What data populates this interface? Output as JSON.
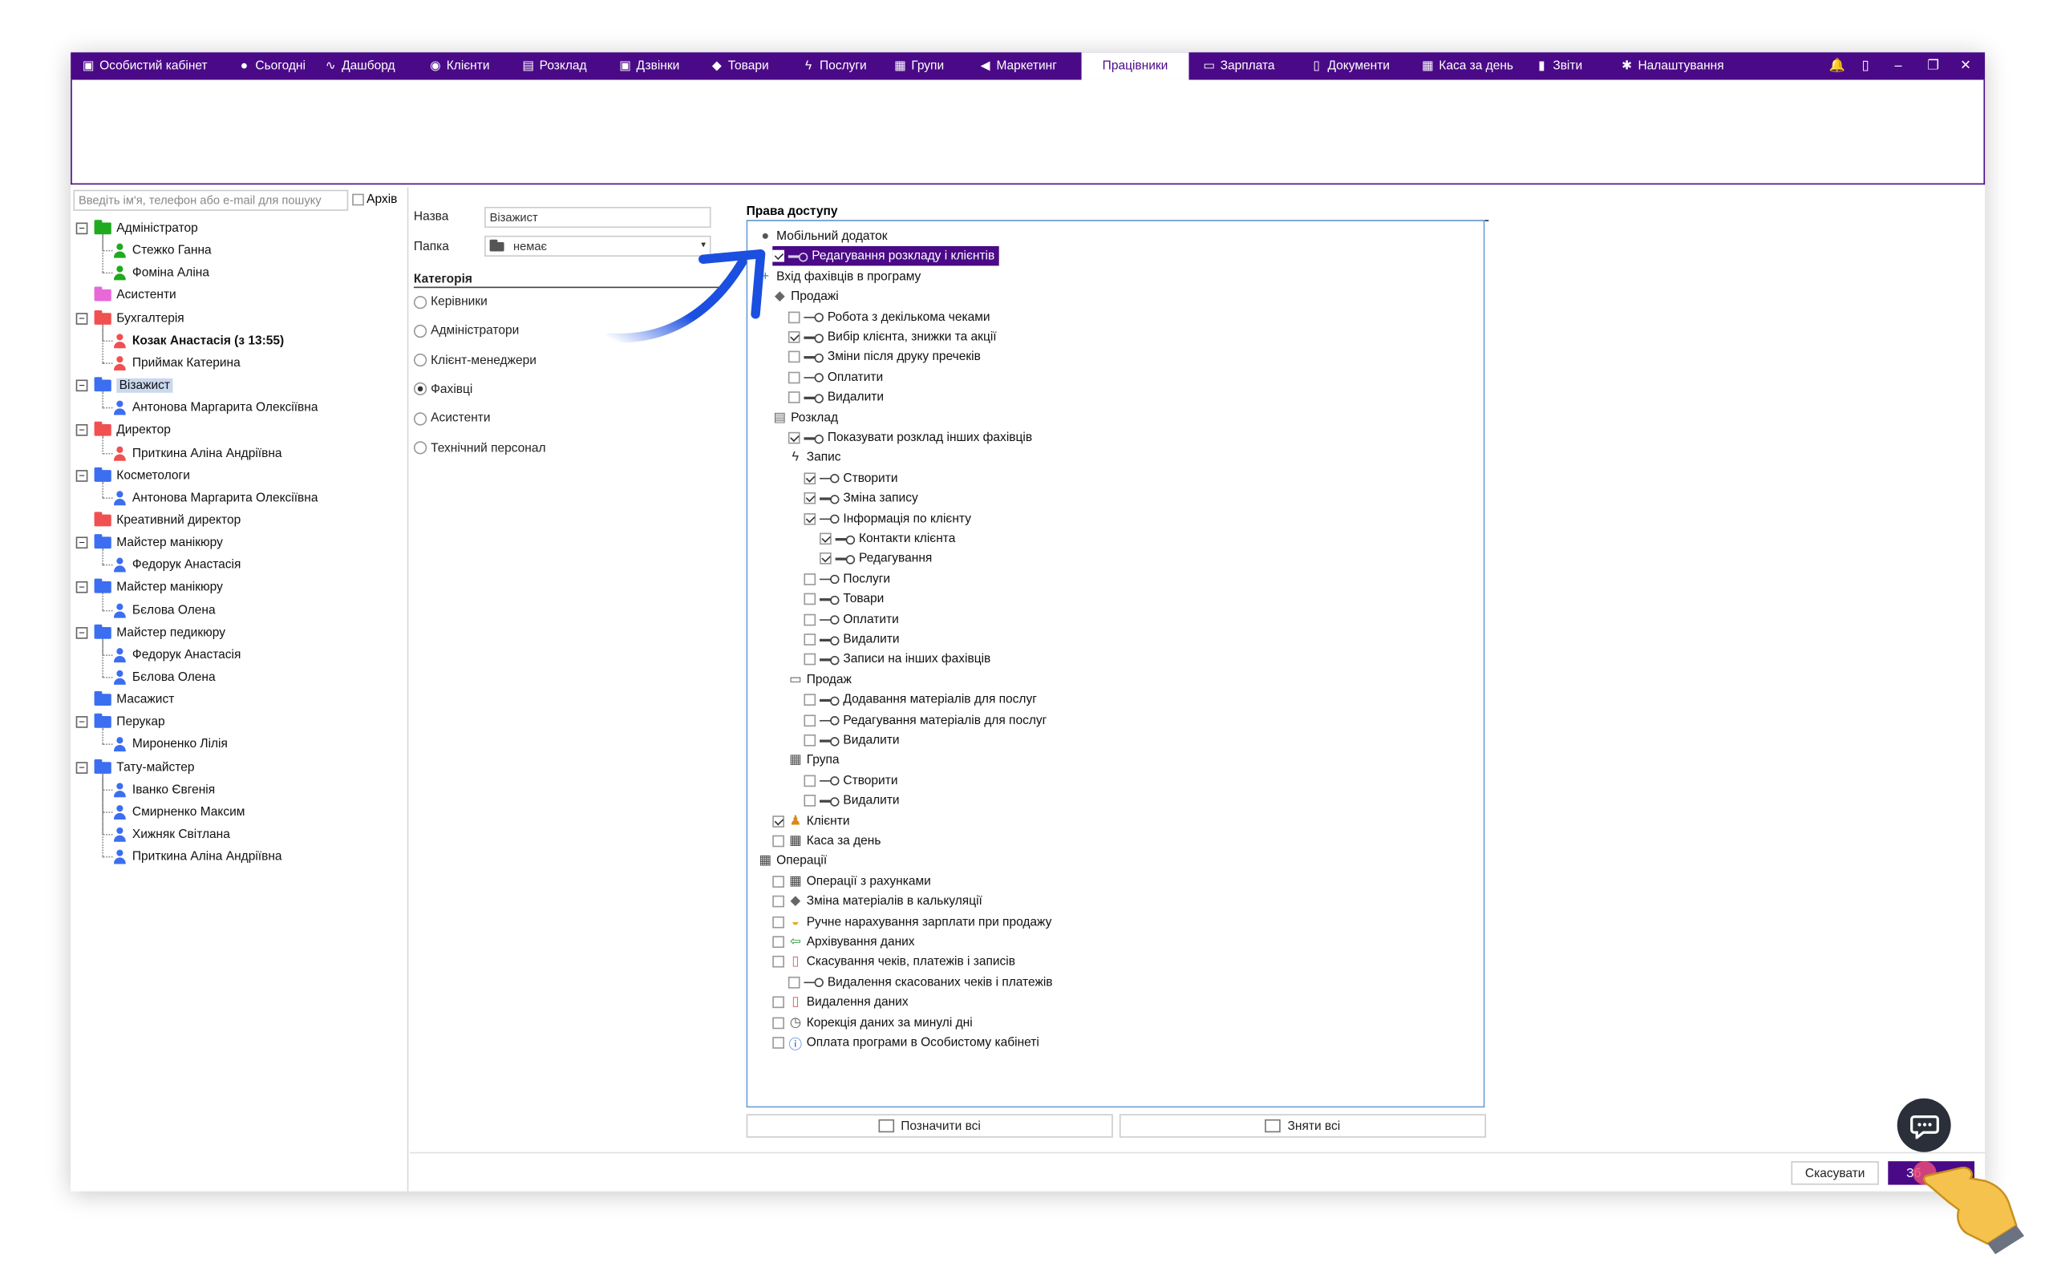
{
  "tabs": [
    {
      "label": "Особистий кабінет",
      "icon": "briefcase-icon"
    },
    {
      "label": "Сьогодні",
      "icon": "clock-icon"
    },
    {
      "label": "Дашборд",
      "icon": "pulse-icon"
    },
    {
      "label": "Клієнти",
      "icon": "user-circle-icon"
    },
    {
      "label": "Розклад",
      "icon": "calendar-icon"
    },
    {
      "label": "Дзвінки",
      "icon": "phone-icon"
    },
    {
      "label": "Товари",
      "icon": "box-icon"
    },
    {
      "label": "Послуги",
      "icon": "lightning-icon"
    },
    {
      "label": "Групи",
      "icon": "group-icon"
    },
    {
      "label": "Маркетинг",
      "icon": "megaphone-icon"
    },
    {
      "label": "Працівники",
      "icon": ""
    },
    {
      "label": "Зарплата",
      "icon": "cash-icon"
    },
    {
      "label": "Документи",
      "icon": "document-icon"
    },
    {
      "label": "Каса за день",
      "icon": "calculator-icon"
    },
    {
      "label": "Звіти",
      "icon": "bar-chart-icon"
    },
    {
      "label": "Налаштування",
      "icon": "gear-icon"
    }
  ],
  "active_tab": "Працівники",
  "window_controls": [
    "bell-icon",
    "lock-icon",
    "minimize-icon",
    "restore-icon",
    "close-icon"
  ],
  "search": {
    "placeholder": "Введіть ім'я, телефон або e-mail для пошуку",
    "archive_label": "Архів"
  },
  "tree": [
    {
      "type": "folder",
      "label": "Адміністратор",
      "color": "#1faa1f",
      "expand": "−"
    },
    {
      "type": "person",
      "label": "Стежко Ганна",
      "color": "#1faa1f"
    },
    {
      "type": "person",
      "label": "Фоміна Аліна",
      "color": "#1faa1f"
    },
    {
      "type": "folder",
      "label": "Асистенти",
      "color": "#e868d8",
      "expand": ""
    },
    {
      "type": "folder",
      "label": "Бухгалтерія",
      "color": "#f05050",
      "expand": "−"
    },
    {
      "type": "person",
      "label": "Козак Анастасія (з 13:55)",
      "color": "#f05050",
      "bold": true
    },
    {
      "type": "person",
      "label": "Приймак Катерина",
      "color": "#f05050"
    },
    {
      "type": "folder",
      "label": "Візажист",
      "color": "#3b6ef0",
      "expand": "−",
      "selected": true
    },
    {
      "type": "person",
      "label": "Антонова Маргарита Олексіївна",
      "color": "#3b6ef0"
    },
    {
      "type": "folder",
      "label": "Директор",
      "color": "#f05050",
      "expand": "−"
    },
    {
      "type": "person",
      "label": "Приткина Аліна Андріївна",
      "color": "#f05050"
    },
    {
      "type": "folder",
      "label": "Косметологи",
      "color": "#3b6ef0",
      "expand": "−"
    },
    {
      "type": "person",
      "label": "Антонова Маргарита Олексіївна",
      "color": "#3b6ef0"
    },
    {
      "type": "folder",
      "label": "Креативний директор",
      "color": "#f05050",
      "expand": ""
    },
    {
      "type": "folder",
      "label": "Майстер манікюру",
      "color": "#3b6ef0",
      "expand": "−"
    },
    {
      "type": "person",
      "label": "Федорук Анастасія",
      "color": "#3b6ef0"
    },
    {
      "type": "folder",
      "label": "Майстер манікюру",
      "color": "#3b6ef0",
      "expand": "−"
    },
    {
      "type": "person",
      "label": "Бєлова Олена",
      "color": "#3b6ef0"
    },
    {
      "type": "folder",
      "label": "Майстер педикюру",
      "color": "#3b6ef0",
      "expand": "−"
    },
    {
      "type": "person",
      "label": "Федорук Анастасія",
      "color": "#3b6ef0"
    },
    {
      "type": "person",
      "label": "Бєлова Олена",
      "color": "#3b6ef0"
    },
    {
      "type": "folder",
      "label": "Масажист",
      "color": "#3b6ef0",
      "expand": ""
    },
    {
      "type": "folder",
      "label": "Перукар",
      "color": "#3b6ef0",
      "expand": "−"
    },
    {
      "type": "person",
      "label": "Мироненко Лілія",
      "color": "#3b6ef0"
    },
    {
      "type": "folder",
      "label": "Тату-майстер",
      "color": "#3b6ef0",
      "expand": "−"
    },
    {
      "type": "person",
      "label": "Іванко Євгенія",
      "color": "#3b6ef0"
    },
    {
      "type": "person",
      "label": "Смирненко Максим",
      "color": "#3b6ef0"
    },
    {
      "type": "person",
      "label": "Хижняк Світлана",
      "color": "#3b6ef0"
    },
    {
      "type": "person",
      "label": "Приткина Аліна Андріївна",
      "color": "#3b6ef0"
    }
  ],
  "form": {
    "name_label": "Назва",
    "name_value": "Візажист",
    "folder_label": "Папка",
    "folder_value": "немає",
    "category_label": "Категорія",
    "categories": [
      {
        "label": "Керівники",
        "selected": false
      },
      {
        "label": "Адміністратори",
        "selected": false
      },
      {
        "label": "Клієнт-менеджери",
        "selected": false
      },
      {
        "label": "Фахівці",
        "selected": true
      },
      {
        "label": "Асистенти",
        "selected": false
      },
      {
        "label": "Технічний персонал",
        "selected": false
      }
    ]
  },
  "rights": {
    "title": "Права доступу",
    "items": [
      {
        "level": 0,
        "label": "Мобільний додаток",
        "icon": "chat-icon",
        "check": null
      },
      {
        "level": 1,
        "label": "Редагування розкладу і клієнтів",
        "key": true,
        "check": true,
        "highlight": true
      },
      {
        "level": 0,
        "label": "Вхід фахівців в програму",
        "icon": "plus-icon",
        "check": null
      },
      {
        "level": 1,
        "label": "Продажі",
        "icon": "box-icon",
        "check": null
      },
      {
        "level": 2,
        "label": "Робота з декількома чеками",
        "key": true,
        "check": false
      },
      {
        "level": 2,
        "label": "Вибір клієнта, знижки та акції",
        "key": true,
        "check": true
      },
      {
        "level": 2,
        "label": "Зміни після друку пречеків",
        "key": true,
        "check": false
      },
      {
        "level": 2,
        "label": "Оплатити",
        "key": true,
        "check": false
      },
      {
        "level": 2,
        "label": "Видалити",
        "key": true,
        "check": false
      },
      {
        "level": 1,
        "label": "Розклад",
        "icon": "calendar-icon",
        "check": null
      },
      {
        "level": 2,
        "label": "Показувати розклад інших фахівців",
        "key": true,
        "check": true
      },
      {
        "level": 2,
        "label": "Запис",
        "icon": "lightning-icon",
        "check": null
      },
      {
        "level": 3,
        "label": "Створити",
        "key": true,
        "check": true
      },
      {
        "level": 3,
        "label": "Зміна запису",
        "key": true,
        "check": true
      },
      {
        "level": 3,
        "label": "Інформація по клієнту",
        "key": true,
        "check": true
      },
      {
        "level": 4,
        "label": "Контакти клієнта",
        "key": true,
        "check": true
      },
      {
        "level": 4,
        "label": "Редагування",
        "key": true,
        "check": true
      },
      {
        "level": 3,
        "label": "Послуги",
        "key": true,
        "check": false
      },
      {
        "level": 3,
        "label": "Товари",
        "key": true,
        "check": false
      },
      {
        "level": 3,
        "label": "Оплатити",
        "key": true,
        "check": false
      },
      {
        "level": 3,
        "label": "Видалити",
        "key": true,
        "check": false
      },
      {
        "level": 3,
        "label": "Записи на інших фахівців",
        "key": true,
        "check": false
      },
      {
        "level": 2,
        "label": "Продаж",
        "icon": "cash-icon",
        "check": null
      },
      {
        "level": 3,
        "label": "Додавання матеріалів для послуг",
        "key": true,
        "check": false
      },
      {
        "level": 3,
        "label": "Редагування матеріалів для послуг",
        "key": true,
        "check": false
      },
      {
        "level": 3,
        "label": "Видалити",
        "key": true,
        "check": false
      },
      {
        "level": 2,
        "label": "Група",
        "icon": "group-icon",
        "check": null
      },
      {
        "level": 3,
        "label": "Створити",
        "key": true,
        "check": false
      },
      {
        "level": 3,
        "label": "Видалити",
        "key": true,
        "check": false
      },
      {
        "level": 1,
        "label": "Клієнти",
        "icon": "clients-icon",
        "check": true
      },
      {
        "level": 1,
        "label": "Каса за день",
        "icon": "calculator-icon",
        "check": false
      },
      {
        "level": 0,
        "label": "Операції",
        "icon": "calculator-icon",
        "check": null
      },
      {
        "level": 1,
        "label": "Операції з рахунками",
        "icon": "calculator-icon",
        "check": false
      },
      {
        "level": 1,
        "label": "Зміна матеріалів в калькуляції",
        "icon": "box-icon",
        "check": false
      },
      {
        "level": 1,
        "label": "Ручне нарахування зарплати при продажу",
        "icon": "coins-icon",
        "check": false
      },
      {
        "level": 1,
        "label": "Архівування даних",
        "icon": "archive-arrow-icon",
        "check": false
      },
      {
        "level": 1,
        "label": "Скасування чеків, платежів і записів",
        "icon": "trash-icon",
        "check": false
      },
      {
        "level": 2,
        "label": "Видалення скасованих чеків і платежів",
        "key": true,
        "check": false
      },
      {
        "level": 1,
        "label": "Видалення даних",
        "icon": "trash-icon",
        "check": false
      },
      {
        "level": 1,
        "label": "Корекція даних за минулі дні",
        "icon": "history-icon",
        "check": false
      },
      {
        "level": 1,
        "label": "Оплата програми в Особистому кабінеті",
        "icon": "info-icon",
        "check": false
      }
    ],
    "select_all": "Позначити всі",
    "deselect_all": "Зняти всі"
  },
  "buttons": {
    "cancel": "Скасувати",
    "save": "Зб"
  },
  "colors": {
    "brand": "#4a0a87",
    "accent_arrow": "#1a4fe0"
  }
}
